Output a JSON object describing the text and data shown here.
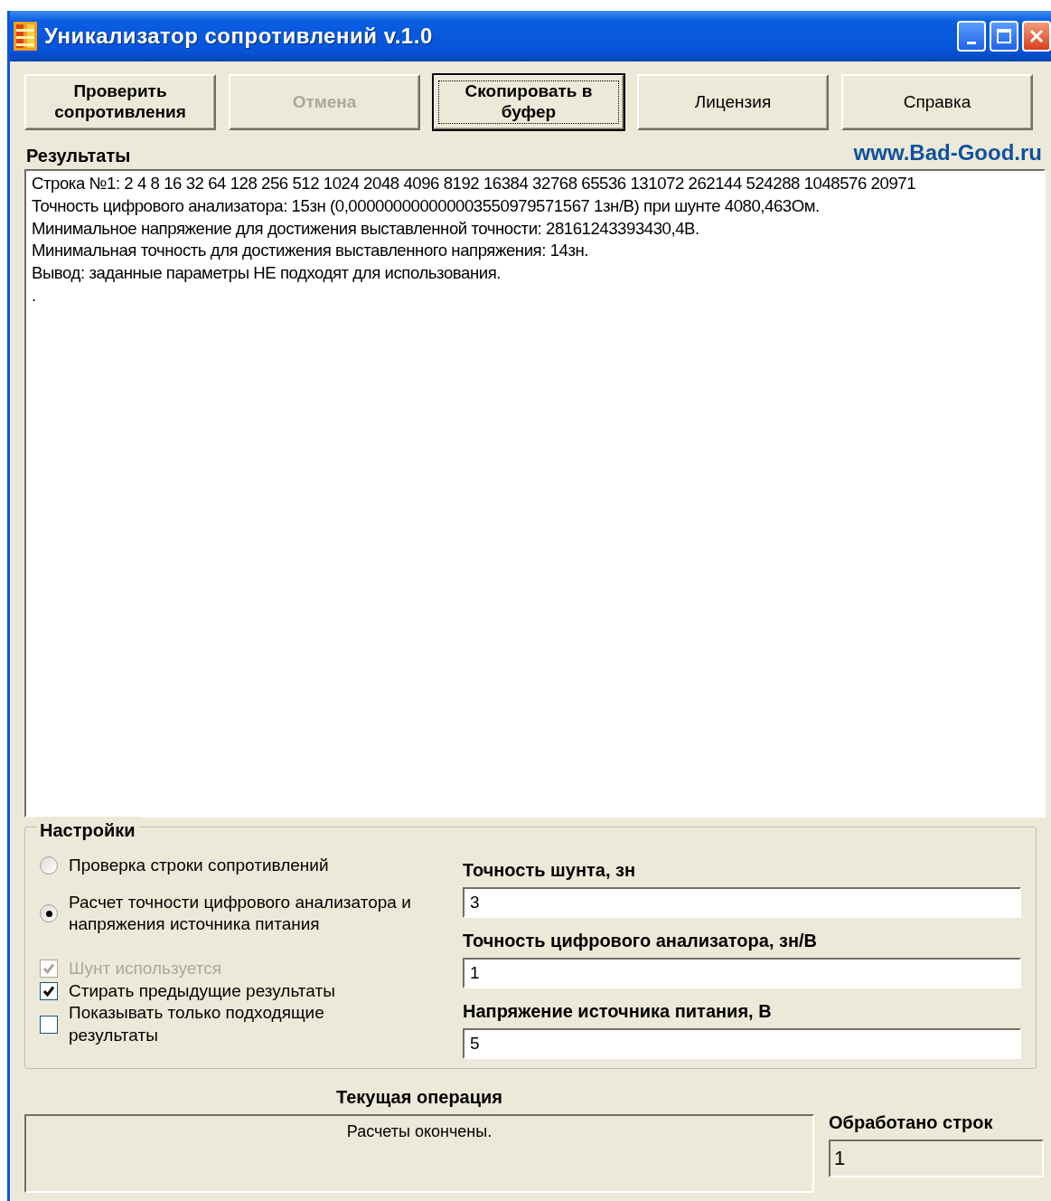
{
  "window": {
    "title": "Уникализатор сопротивлений v.1.0"
  },
  "buttons": [
    {
      "label": "Проверить сопротивления",
      "disabled": false,
      "focused": false
    },
    {
      "label": "Отмена",
      "disabled": true,
      "focused": false
    },
    {
      "label": "Скопировать в буфер",
      "disabled": false,
      "focused": true
    },
    {
      "label": "Лицензия",
      "disabled": false,
      "focused": false
    },
    {
      "label": "Справка",
      "disabled": false,
      "focused": false
    }
  ],
  "results": {
    "label": "Результаты",
    "link": "www.Bad-Good.ru",
    "lines": [
      "Строка №1: 2 4 8 16 32 64 128 256 512 1024 2048 4096 8192 16384 32768 65536 131072 262144 524288 1048576 20971",
      "Точность цифрового анализатора: 15зн (0,000000000000003550979571567 1зн/В) при шунте 4080,463Ом.",
      "Минимальное напряжение для достижения выставленной точности: 28161243393430,4В.",
      "Минимальная точность для достижения выставленного напряжения: 14зн.",
      "Вывод: заданные параметры НЕ подходят для использования.",
      "."
    ]
  },
  "settings": {
    "title": "Настройки",
    "modes": [
      {
        "label": "Проверка строки сопротивлений",
        "selected": false
      },
      {
        "label": "Расчет точности цифрового анализатора и напряжения источника питания",
        "selected": true
      }
    ],
    "options": [
      {
        "label": "Шунт используется",
        "checked": true,
        "disabled": true
      },
      {
        "label": "Стирать предыдущие результаты",
        "checked": true,
        "disabled": false
      },
      {
        "label": "Показывать только подходящие результаты",
        "checked": false,
        "disabled": false
      }
    ],
    "fields": [
      {
        "label": "Точность шунта, зн",
        "value": "3"
      },
      {
        "label": "Точность цифрового анализатора, зн/В",
        "value": "1"
      },
      {
        "label": "Напряжение источника питания, В",
        "value": "5"
      }
    ]
  },
  "status": {
    "operation_label": "Текущая операция",
    "operation_text": "Расчеты окончены.",
    "rows_label": "Обработано строк",
    "rows_value": "1"
  }
}
